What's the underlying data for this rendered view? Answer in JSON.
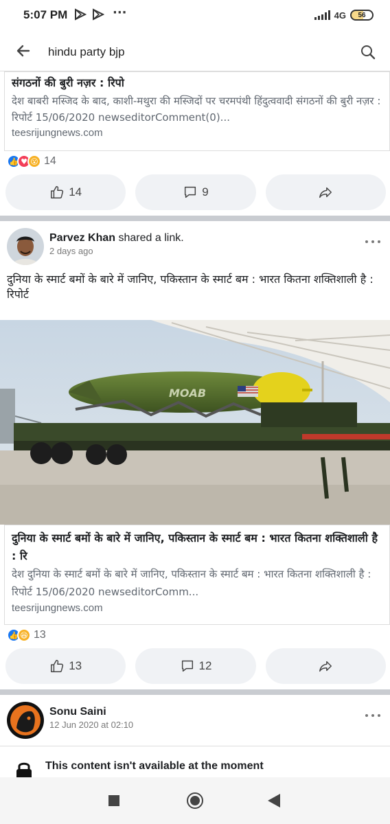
{
  "status_bar": {
    "time": "5:07 PM",
    "network": "4G",
    "battery": "56",
    "icons": [
      "play-store-icon",
      "play-store-icon",
      "more-dots-icon",
      "signal-icon",
      "battery-icon"
    ]
  },
  "search": {
    "query": "hindu party bjp",
    "back_icon": "arrow-left-icon",
    "search_icon": "search-icon"
  },
  "post1": {
    "link_title": "संगठनों की बुरी नज़र : रिपो",
    "link_description": "देश बाबरी मस्जिद के बाद, काशी-मथुरा की मस्जिदों पर चरमपंथी हिंदुत्ववादी संगठनों की बुरी नज़र : रिपोर्ट 15/06/2020 newseditorComment(0)...",
    "link_domain": "teesrijungnews.com",
    "reaction_count": "14",
    "reactions": [
      "like",
      "love",
      "wow"
    ],
    "like_count": "14",
    "comment_count": "9"
  },
  "post2": {
    "author": "Parvez Khan",
    "action": "shared a link.",
    "time": "2 days ago",
    "text": "दुनिया के स्मार्ट बमों के बारे में जानिए, पकिस्तान के स्मार्ट बम : भारत कितना शक्तिशाली है : रिपोर्ट",
    "image_label": "MOAB",
    "link_title": "दुनिया के स्मार्ट बमों के बारे में जानिए, पकिस्तान के स्मार्ट बम : भारत कितना शक्तिशाली है : रि",
    "link_description": "देश दुनिया के स्मार्ट बमों के बारे में जानिए, पकिस्तान के स्मार्ट बम : भारत कितना शक्तिशाली है : रिपोर्ट 15/06/2020 newseditorComm...",
    "link_domain": "teesrijungnews.com",
    "reaction_count": "13",
    "reactions": [
      "like",
      "haha"
    ],
    "like_count": "13",
    "comment_count": "12"
  },
  "post3": {
    "author": "Sonu Saini",
    "time": "12 Jun 2020 at 02:10",
    "unavailable_text": "This content isn't available at the moment"
  },
  "colors": {
    "like_blue": "#1877f2",
    "love_red": "#f33e58",
    "wow_yellow": "#f7b125",
    "pill_bg": "#f0f2f5",
    "divider": "#c9ccd1"
  }
}
